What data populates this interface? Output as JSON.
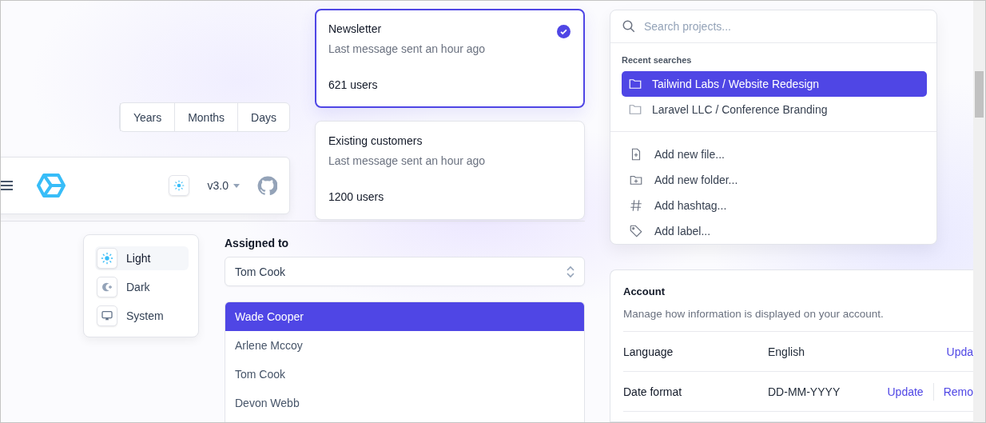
{
  "range_tabs": [
    {
      "label": "Years",
      "selected": false
    },
    {
      "label": "Months",
      "selected": false
    },
    {
      "label": "Days",
      "selected": false
    }
  ],
  "navbar": {
    "version": "v3.0"
  },
  "lists": [
    {
      "title": "Newsletter",
      "subtitle": "Last message sent an hour ago",
      "count": "621 users",
      "selected": true
    },
    {
      "title": "Existing customers",
      "subtitle": "Last message sent an hour ago",
      "count": "1200 users",
      "selected": false
    }
  ],
  "theme_menu": [
    {
      "kind": "sun",
      "label": "Light",
      "selected": true
    },
    {
      "kind": "moon",
      "label": "Dark",
      "selected": false
    },
    {
      "kind": "monitor",
      "label": "System",
      "selected": false
    }
  ],
  "assignee": {
    "label": "Assigned to",
    "value": "Tom Cook",
    "options": [
      {
        "label": "Wade Cooper",
        "highlighted": true
      },
      {
        "label": "Arlene Mccoy",
        "highlighted": false
      },
      {
        "label": "Tom Cook",
        "highlighted": false
      },
      {
        "label": "Devon Webb",
        "highlighted": false
      }
    ]
  },
  "palette": {
    "placeholder": "Search projects...",
    "recent_title": "Recent searches",
    "recent": [
      {
        "label": "Tailwind Labs / Website Redesign",
        "selected": true
      },
      {
        "label": "Laravel LLC / Conference Branding",
        "selected": false
      }
    ],
    "actions": [
      {
        "kind": "file",
        "label": "Add new file..."
      },
      {
        "kind": "folder",
        "label": "Add new folder..."
      },
      {
        "kind": "hashtag",
        "label": "Add hashtag..."
      },
      {
        "kind": "tag",
        "label": "Add label..."
      }
    ]
  },
  "account": {
    "title": "Account",
    "description": "Manage how information is displayed on your account.",
    "rows": [
      {
        "label": "Language",
        "value": "English",
        "actions": [
          "Upda"
        ]
      },
      {
        "label": "Date format",
        "value": "DD-MM-YYYY",
        "actions": [
          "Update",
          "Remo"
        ]
      }
    ]
  }
}
